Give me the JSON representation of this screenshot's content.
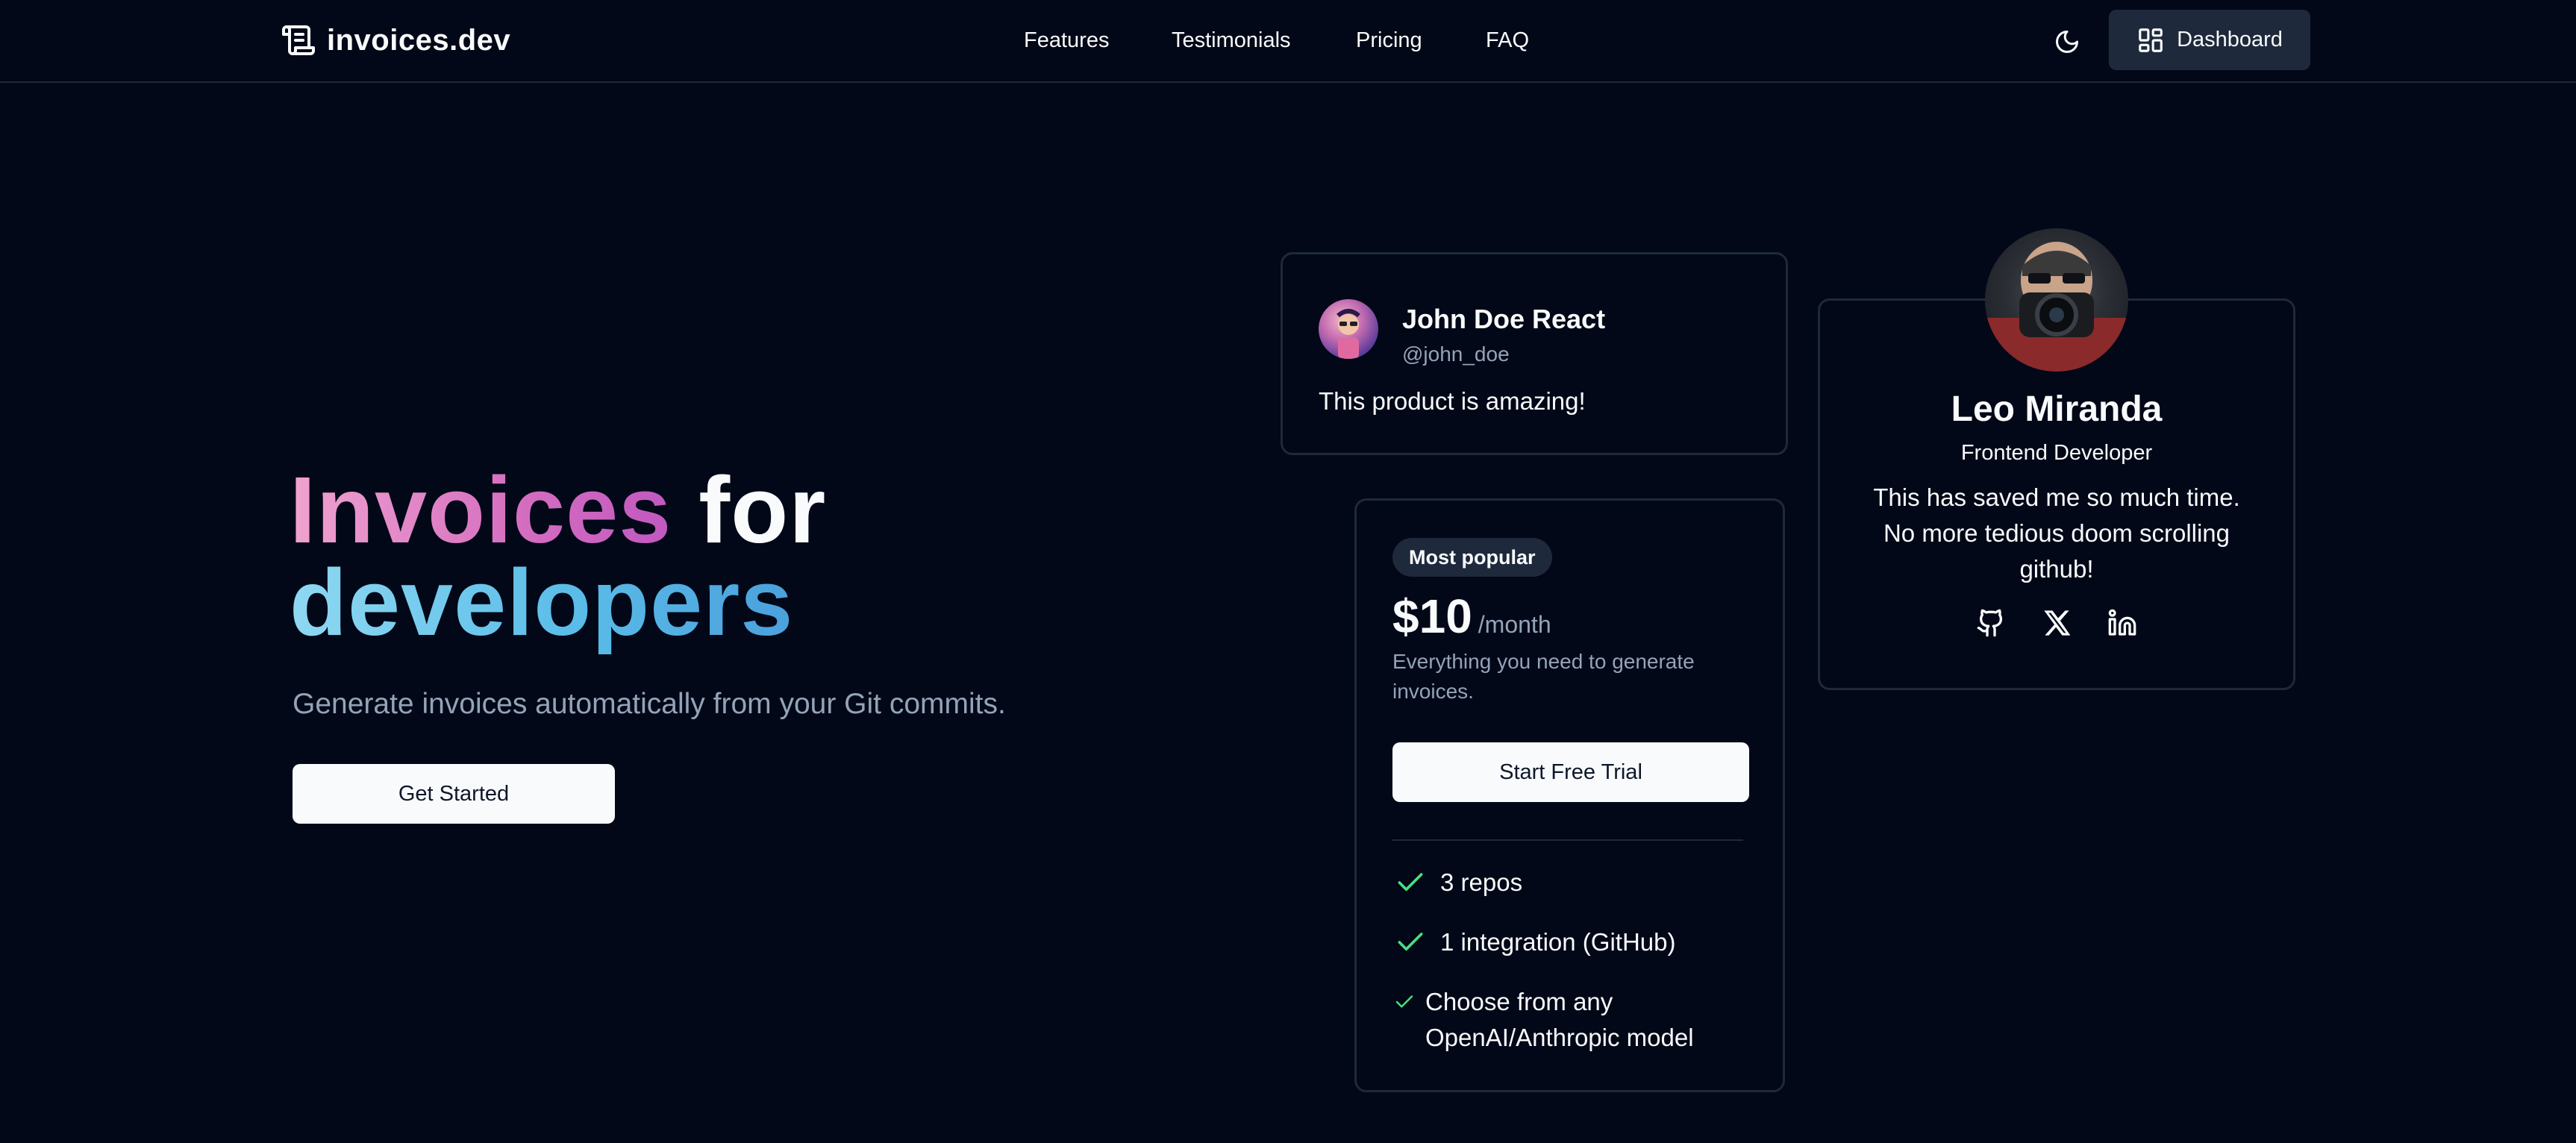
{
  "navbar": {
    "brand": "invoices.dev",
    "brand_icon": "scroll-icon",
    "links": [
      "Features",
      "Testimonials",
      "Pricing",
      "FAQ"
    ],
    "theme_icon": "moon-icon",
    "dashboard_label": "Dashboard",
    "dashboard_icon": "layout-dashboard-icon"
  },
  "hero": {
    "title_word1": "Invoices",
    "title_word2": "for",
    "title_word3": "developers",
    "subtitle": "Generate invoices automatically from your Git commits.",
    "cta": "Get Started"
  },
  "testimonial_john": {
    "name": "John Doe React",
    "handle": "@john_doe",
    "text": "This product is amazing!"
  },
  "testimonial_leo": {
    "name": "Leo Miranda",
    "role": "Frontend Developer",
    "text": "This has saved me so much time. No more tedious doom scrolling github!",
    "socials": [
      "github-icon",
      "x-icon",
      "linkedin-icon"
    ]
  },
  "pricing": {
    "badge": "Most popular",
    "price": "$10",
    "period": "/month",
    "description": "Everything you need to generate invoices.",
    "cta": "Start Free Trial",
    "features": [
      "3 repos",
      "1 integration (GitHub)",
      "Choose from any OpenAI/Anthropic model"
    ]
  },
  "colors": {
    "background": "#020817",
    "border": "#1e293b",
    "muted_text": "#94a3b8",
    "check_green": "#4ade80",
    "gradient_pink": "#d56ec0",
    "gradient_blue": "#5bbde8"
  }
}
